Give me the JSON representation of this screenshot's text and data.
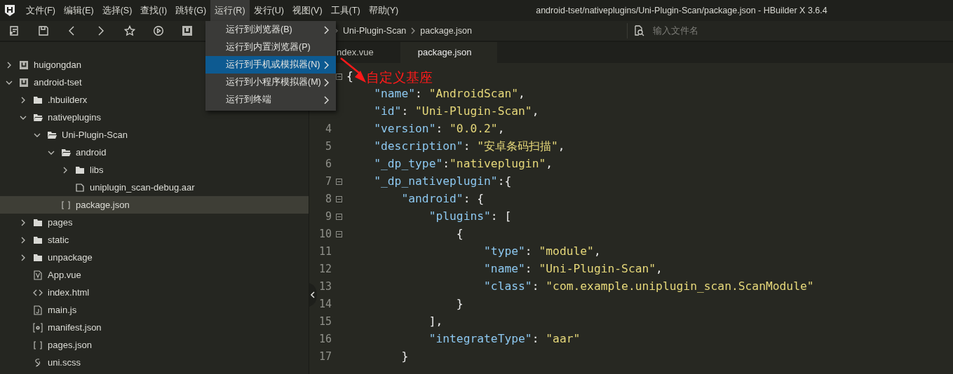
{
  "window": {
    "title": "android-tset/nativeplugins/Uni-Plugin-Scan/package.json - HBuilder X 3.6.4"
  },
  "menu_bar": [
    {
      "label": "文件(F)",
      "selected": false
    },
    {
      "label": "编辑(E)",
      "selected": false
    },
    {
      "label": "选择(S)",
      "selected": false
    },
    {
      "label": "查找(I)",
      "selected": false
    },
    {
      "label": "跳转(G)",
      "selected": false
    },
    {
      "label": "运行(R)",
      "selected": true
    },
    {
      "label": "发行(U)",
      "selected": false
    },
    {
      "label": "视图(V)",
      "selected": false
    },
    {
      "label": "工具(T)",
      "selected": false
    },
    {
      "label": "帮助(Y)",
      "selected": false
    }
  ],
  "run_menu": [
    {
      "label": "运行到浏览器(B)",
      "has_submenu": true,
      "selected": false
    },
    {
      "label": "运行到内置浏览器(P)",
      "has_submenu": false,
      "selected": false
    },
    {
      "label": "运行到手机或模拟器(N)",
      "has_submenu": true,
      "selected": true
    },
    {
      "label": "运行到小程序模拟器(M)",
      "has_submenu": true,
      "selected": false
    },
    {
      "label": "运行到终端",
      "has_submenu": true,
      "selected": false
    }
  ],
  "toolbar": {
    "breadcrumb": [
      "Uni-Plugin-Scan",
      "package.json"
    ],
    "search": {
      "placeholder": "输入文件名"
    }
  },
  "project_tree": [
    {
      "label": "huigongdan",
      "kind": "project",
      "expanded": false,
      "selected": false
    },
    {
      "label": "android-tset",
      "kind": "project",
      "expanded": true,
      "selected": false,
      "children": [
        {
          "label": ".hbuilderx",
          "kind": "folder",
          "expanded": false,
          "selected": false
        },
        {
          "label": "nativeplugins",
          "kind": "folder",
          "expanded": true,
          "selected": false,
          "children": [
            {
              "label": "Uni-Plugin-Scan",
              "kind": "folder",
              "expanded": true,
              "selected": false,
              "children": [
                {
                  "label": "android",
                  "kind": "folder",
                  "expanded": true,
                  "selected": false,
                  "children": [
                    {
                      "label": "libs",
                      "kind": "folder",
                      "expanded": false,
                      "selected": false
                    },
                    {
                      "label": "uniplugin_scan-debug.aar",
                      "kind": "file",
                      "selected": false
                    }
                  ]
                },
                {
                  "label": "package.json",
                  "kind": "json",
                  "selected": true
                }
              ]
            }
          ]
        },
        {
          "label": "pages",
          "kind": "folder",
          "expanded": false,
          "selected": false
        },
        {
          "label": "static",
          "kind": "folder",
          "expanded": false,
          "selected": false
        },
        {
          "label": "unpackage",
          "kind": "folder",
          "expanded": false,
          "selected": false
        },
        {
          "label": "App.vue",
          "kind": "vue",
          "selected": false
        },
        {
          "label": "index.html",
          "kind": "html",
          "selected": false
        },
        {
          "label": "main.js",
          "kind": "js",
          "selected": false
        },
        {
          "label": "manifest.json",
          "kind": "manifest",
          "selected": false
        },
        {
          "label": "pages.json",
          "kind": "json",
          "selected": false
        },
        {
          "label": "uni.scss",
          "kind": "scss",
          "selected": false
        }
      ]
    }
  ],
  "editor": {
    "tabs": [
      {
        "label": "ndex.vue",
        "selected": false
      },
      {
        "label": "package.json",
        "selected": true
      }
    ],
    "lines": [
      {
        "fold": true,
        "tokens": [
          {
            "kind": "punct",
            "text": "{"
          }
        ]
      },
      {
        "tokens": [
          {
            "kind": "key",
            "text": "    \"name\""
          },
          {
            "kind": "punct",
            "text": ": "
          },
          {
            "kind": "string",
            "text": "\"AndroidScan\""
          },
          {
            "kind": "punct",
            "text": ","
          }
        ]
      },
      {
        "tokens": [
          {
            "kind": "key",
            "text": "    \"id\""
          },
          {
            "kind": "punct",
            "text": ": "
          },
          {
            "kind": "string",
            "text": "\"Uni-Plugin-Scan\""
          },
          {
            "kind": "punct",
            "text": ","
          }
        ]
      },
      {
        "number": "4",
        "tokens": [
          {
            "kind": "key",
            "text": "    \"version\""
          },
          {
            "kind": "punct",
            "text": ": "
          },
          {
            "kind": "string",
            "text": "\"0.0.2\""
          },
          {
            "kind": "punct",
            "text": ","
          }
        ]
      },
      {
        "number": "5",
        "tokens": [
          {
            "kind": "key",
            "text": "    \"description\""
          },
          {
            "kind": "punct",
            "text": ": "
          },
          {
            "kind": "string",
            "text": "\"安卓条码扫描\""
          },
          {
            "kind": "punct",
            "text": ","
          }
        ]
      },
      {
        "number": "6",
        "tokens": [
          {
            "kind": "key",
            "text": "    \"_dp_type\""
          },
          {
            "kind": "punct",
            "text": ":"
          },
          {
            "kind": "string",
            "text": "\"nativeplugin\""
          },
          {
            "kind": "punct",
            "text": ","
          }
        ]
      },
      {
        "number": "7",
        "fold": true,
        "tokens": [
          {
            "kind": "key",
            "text": "    \"_dp_nativeplugin\""
          },
          {
            "kind": "punct",
            "text": ":{"
          }
        ]
      },
      {
        "number": "8",
        "fold": true,
        "tokens": [
          {
            "kind": "key",
            "text": "        \"android\""
          },
          {
            "kind": "punct",
            "text": ": {"
          }
        ]
      },
      {
        "number": "9",
        "fold": true,
        "tokens": [
          {
            "kind": "key",
            "text": "            \"plugins\""
          },
          {
            "kind": "punct",
            "text": ": ["
          }
        ]
      },
      {
        "number": "10",
        "fold": true,
        "tokens": [
          {
            "kind": "punct",
            "text": "                {"
          }
        ]
      },
      {
        "number": "11",
        "tokens": [
          {
            "kind": "key",
            "text": "                    \"type\""
          },
          {
            "kind": "punct",
            "text": ": "
          },
          {
            "kind": "string",
            "text": "\"module\""
          },
          {
            "kind": "punct",
            "text": ","
          }
        ]
      },
      {
        "number": "12",
        "tokens": [
          {
            "kind": "key",
            "text": "                    \"name\""
          },
          {
            "kind": "punct",
            "text": ": "
          },
          {
            "kind": "string",
            "text": "\"Uni-Plugin-Scan\""
          },
          {
            "kind": "punct",
            "text": ","
          }
        ]
      },
      {
        "number": "13",
        "tokens": [
          {
            "kind": "key",
            "text": "                    \"class\""
          },
          {
            "kind": "punct",
            "text": ": "
          },
          {
            "kind": "string",
            "text": "\"com.example.uniplugin_scan.ScanModule\""
          }
        ]
      },
      {
        "number": "14",
        "tokens": [
          {
            "kind": "punct",
            "text": "                }"
          }
        ]
      },
      {
        "number": "15",
        "tokens": [
          {
            "kind": "punct",
            "text": "            ],"
          }
        ]
      },
      {
        "number": "16",
        "tokens": [
          {
            "kind": "key",
            "text": "            \"integrateType\""
          },
          {
            "kind": "punct",
            "text": ": "
          },
          {
            "kind": "string",
            "text": "\"aar\""
          }
        ]
      },
      {
        "number": "17",
        "tokens": [
          {
            "kind": "punct",
            "text": "        }"
          }
        ]
      }
    ]
  },
  "annotation": {
    "text": "自定义基座"
  }
}
